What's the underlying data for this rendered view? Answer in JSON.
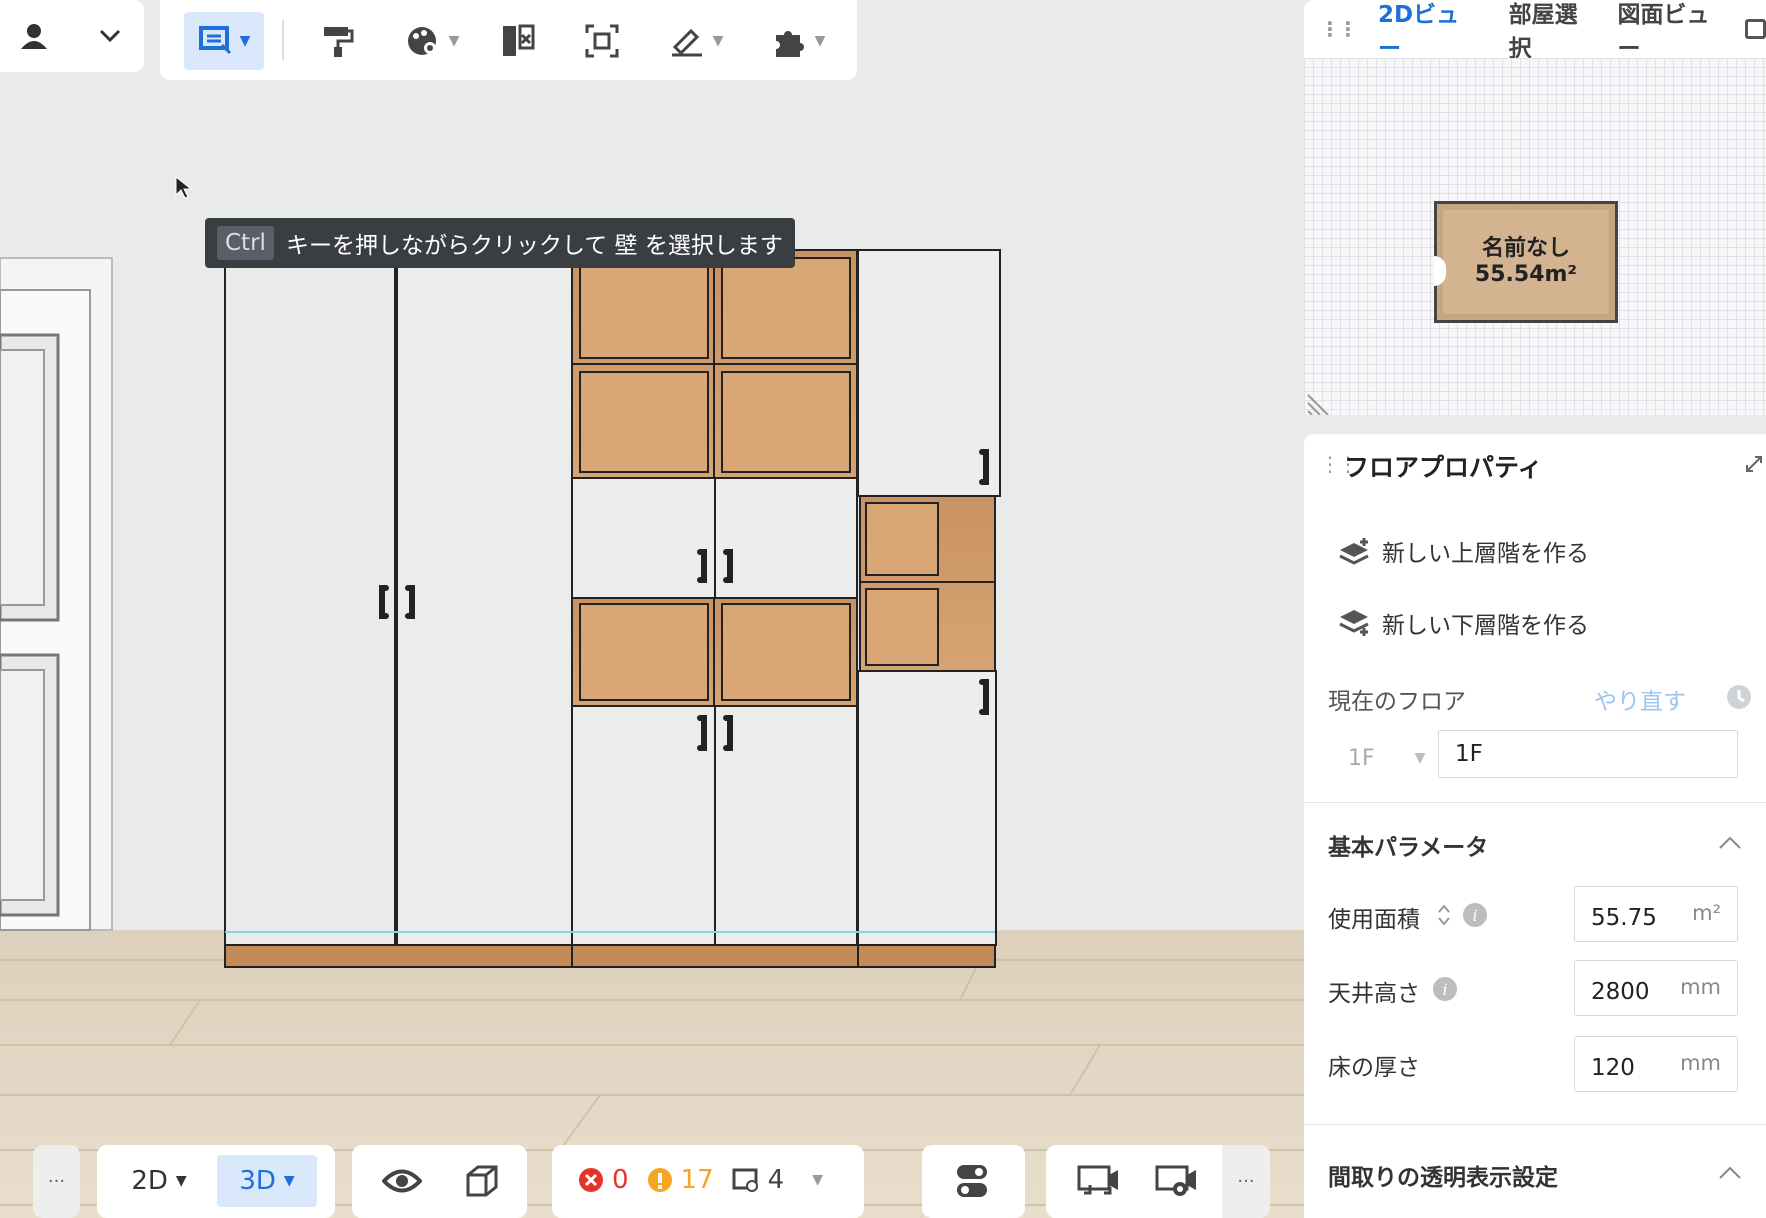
{
  "top_toolbar": {
    "user_menu_icon": "user-icon",
    "user_caret": "chevron-down-icon",
    "tools": [
      "select-tool-icon",
      "paint-roller-icon",
      "material-palette-icon",
      "split-wall-icon",
      "frame-select-icon",
      "level-tool-icon",
      "plugin-icon"
    ]
  },
  "hint": {
    "key": "Ctrl",
    "text": "キーを押しながらクリックして 壁 を選択します"
  },
  "minimap": {
    "tabs": [
      "2Dビュー",
      "部屋選択",
      "図面ビュー"
    ],
    "active_tab": "2Dビュー",
    "room_name": "名前なし",
    "room_area": "55.54m²"
  },
  "properties": {
    "title": "フロアプロパティ",
    "create_upper": "新しい上層階を作る",
    "create_lower": "新しい下層階を作る",
    "current_floor_label": "現在のフロア",
    "redo_label": "やり直す",
    "floor_select_value": "1F",
    "floor_name_value": "1F",
    "basic_params_title": "基本パラメータ",
    "area_label": "使用面積",
    "area_value": "55.75",
    "area_unit": "m²",
    "ceiling_label": "天井高さ",
    "ceiling_value": "2800",
    "ceiling_unit": "mm",
    "floor_thickness_label": "床の厚さ",
    "floor_thickness_value": "120",
    "floor_thickness_unit": "mm",
    "transparency_title": "間取りの透明表示設定"
  },
  "bottom_bar": {
    "more_label": "···",
    "view_2d": "2D",
    "view_3d": "3D",
    "error_count": "0",
    "warning_count": "17",
    "item_count": "4",
    "more_label_right": "···"
  },
  "colors": {
    "accent": "#1e6fd9",
    "error": "#e5352b",
    "warning": "#f5a623",
    "wood": "#c9925e"
  }
}
